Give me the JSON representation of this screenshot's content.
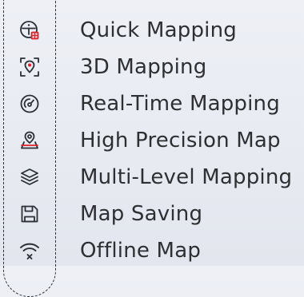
{
  "menu": {
    "items": [
      {
        "label": "Quick Mapping",
        "icon": "quick-mapping-icon"
      },
      {
        "label": "3D Mapping",
        "icon": "3d-mapping-icon"
      },
      {
        "label": "Real-Time Mapping",
        "icon": "real-time-mapping-icon"
      },
      {
        "label": "High Precision Map",
        "icon": "high-precision-map-icon"
      },
      {
        "label": "Multi-Level Mapping",
        "icon": "multi-level-mapping-icon"
      },
      {
        "label": "Map Saving",
        "icon": "map-saving-icon"
      },
      {
        "label": "Offline Map",
        "icon": "offline-map-icon"
      }
    ]
  },
  "colors": {
    "text": "#2d2f33",
    "icon_stroke": "#2b2f36",
    "accent": "#e0202a",
    "background": "#e9ebf2"
  }
}
